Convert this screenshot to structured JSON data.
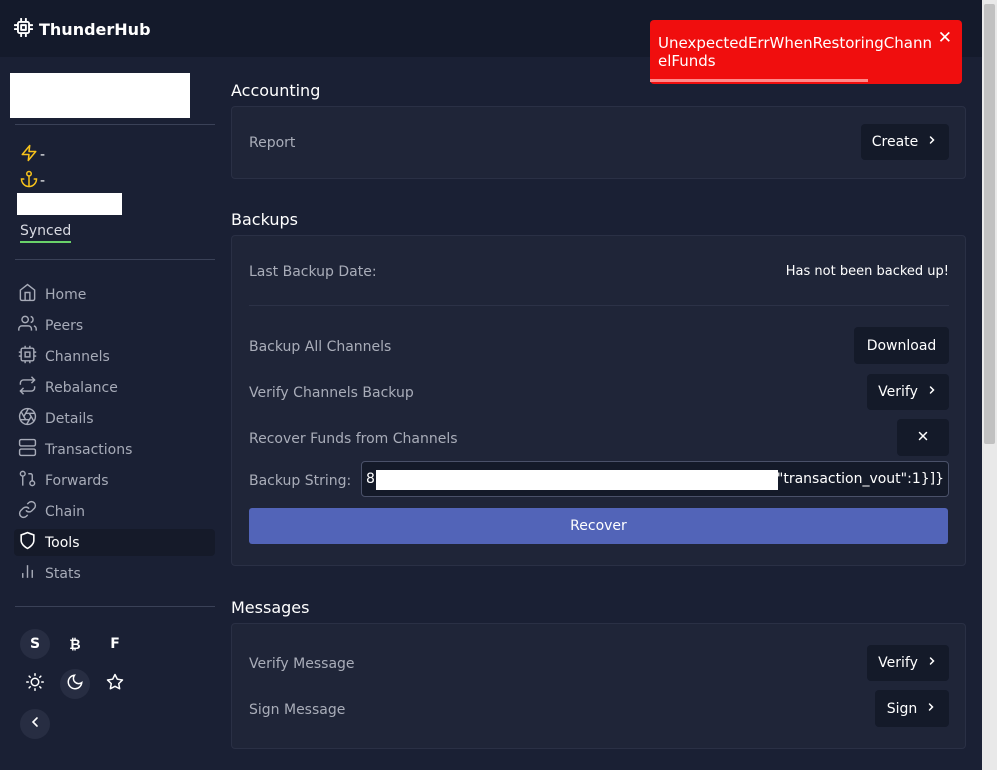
{
  "app": {
    "name": "ThunderHub"
  },
  "sidebar": {
    "balance_lightning": "-",
    "balance_chain": "-",
    "sync_status": "Synced",
    "nav": [
      {
        "label": "Home",
        "icon": "home-icon"
      },
      {
        "label": "Peers",
        "icon": "users-icon"
      },
      {
        "label": "Channels",
        "icon": "cpu-icon"
      },
      {
        "label": "Rebalance",
        "icon": "repeat-icon"
      },
      {
        "label": "Details",
        "icon": "aperture-icon"
      },
      {
        "label": "Transactions",
        "icon": "server-icon"
      },
      {
        "label": "Forwards",
        "icon": "git-pull-request-icon"
      },
      {
        "label": "Chain",
        "icon": "link-icon"
      },
      {
        "label": "Tools",
        "icon": "shield-icon",
        "active": true
      },
      {
        "label": "Stats",
        "icon": "bar-chart-icon"
      }
    ],
    "currency_buttons": [
      "S",
      "₿",
      "F"
    ],
    "theme_buttons": [
      "sun-icon",
      "moon-icon",
      "star-icon"
    ]
  },
  "toast": {
    "message": "UnexpectedErrWhenRestoringChannelFunds",
    "progress": 0.7
  },
  "accounting": {
    "title": "Accounting",
    "report_label": "Report",
    "create_button": "Create"
  },
  "backups": {
    "title": "Backups",
    "last_backup_label": "Last Backup Date:",
    "last_backup_value": "Has not been backed up!",
    "backup_all_label": "Backup All Channels",
    "download_button": "Download",
    "verify_label": "Verify Channels Backup",
    "verify_button": "Verify",
    "recover_label": "Recover Funds from Channels",
    "backup_string_label": "Backup String:",
    "backup_string_prefix": "8",
    "backup_string_suffix": "6\",\"transaction_vout\":1}]}",
    "recover_button": "Recover"
  },
  "messages": {
    "title": "Messages",
    "verify_label": "Verify Message",
    "verify_button": "Verify",
    "sign_label": "Sign Message",
    "sign_button": "Sign"
  },
  "colors": {
    "background": "#1a2034",
    "card": "#1f2538",
    "accent": "#5264b8",
    "toast": "#f00e0e",
    "synced_underline": "#6ad26a",
    "icon_yellow": "#f7c21b"
  }
}
